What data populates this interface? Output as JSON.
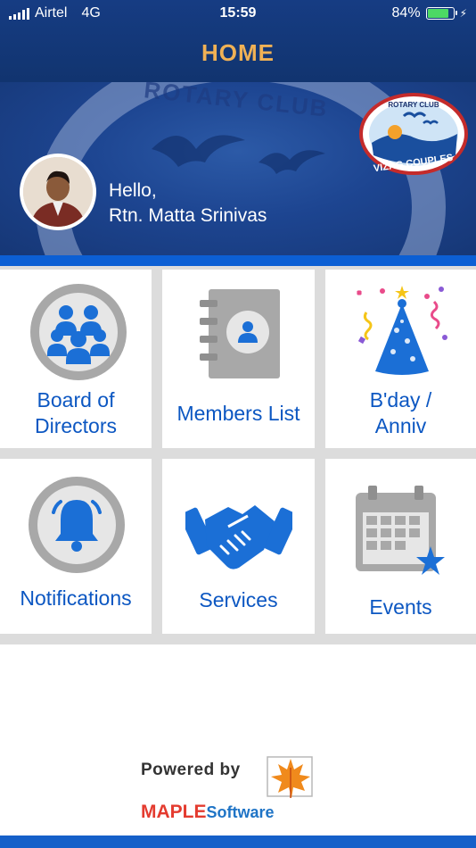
{
  "status_bar": {
    "carrier": "Airtel",
    "network": "4G",
    "time": "15:59",
    "battery": "84%",
    "battery_level": 0.84
  },
  "header": {
    "title": "HOME"
  },
  "banner": {
    "club_text": "ROTARY CLUB",
    "badge_top": "ROTARY CLUB",
    "badge_bottom": "VIZAG COUPLES",
    "greeting": "Hello,",
    "user_name": "Rtn. Matta Srinivas"
  },
  "tiles": [
    {
      "label_line1": "Board of",
      "label_line2": "Directors",
      "icon": "group-icon"
    },
    {
      "label_line1": "Members List",
      "label_line2": "",
      "icon": "address-book-icon"
    },
    {
      "label_line1": "B'day /",
      "label_line2": "Anniv",
      "icon": "party-hat-icon"
    },
    {
      "label_line1": "Notifications",
      "label_line2": "",
      "icon": "bell-icon"
    },
    {
      "label_line1": "Services",
      "label_line2": "",
      "icon": "handshake-icon"
    },
    {
      "label_line1": "Events",
      "label_line2": "",
      "icon": "calendar-icon"
    }
  ],
  "footer": {
    "powered_by": "Powered by",
    "brand_main": "MAPLE",
    "brand_sub": "Software"
  },
  "colors": {
    "header_bg": "#163c83",
    "header_title": "#f0b155",
    "tile_label": "#0c57c2",
    "icon_blue": "#1b6fd6",
    "icon_grey": "#a8a8a8"
  }
}
